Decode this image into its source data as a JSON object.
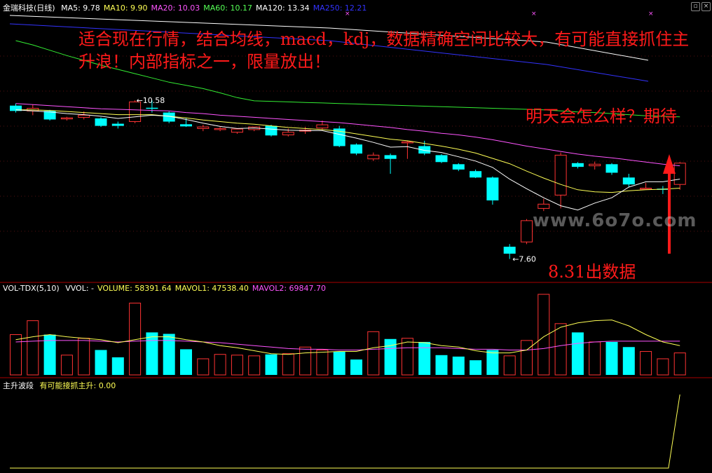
{
  "main_header": {
    "title": "金瑞科技(日线)",
    "items": [
      {
        "label": "MA5: 9.78",
        "color": "#ffffff"
      },
      {
        "label": "MA10: 9.90",
        "color": "#ffff55"
      },
      {
        "label": "MA20: 10.03",
        "color": "#ff55ff"
      },
      {
        "label": "MA60: 10.17",
        "color": "#55ff55"
      },
      {
        "label": "MA120: 13.34",
        "color": "#ffffff"
      },
      {
        "label": "MA250: 12.21",
        "color": "#3333ff"
      }
    ]
  },
  "volume_header": {
    "title": "VOL-TDX(5,10)",
    "items": [
      {
        "label": "VVOL: -",
        "color": "#ffffff"
      },
      {
        "label": "VOLUME: 58391.64",
        "color": "#ffff55"
      },
      {
        "label": "MAVOL1: 47538.40",
        "color": "#ffff55"
      },
      {
        "label": "MAVOL2: 69847.70",
        "color": "#ff55ff"
      }
    ]
  },
  "indicator_header": {
    "title": "主升波段",
    "items": [
      {
        "label": "有可能接抓主升: 0.00",
        "color": "#ffff55"
      }
    ]
  },
  "annotations": {
    "title": "适合现在行情，结合均线，macd，kdj，数据精确空间比较大，有可能直接抓住主升浪！内部指标之一，限量放出！",
    "tomorrow": "明天会怎么样？期待",
    "date_note": "8.31出数据"
  },
  "watermark": "www.6o7o.com",
  "chart_data": [
    {
      "type": "candlestick",
      "name": "金瑞科技(日线)",
      "ylim": [
        7.2,
        12.2
      ],
      "colors": {
        "up": "#ff3333",
        "down": "#00ffff",
        "ma5": "#ffffff",
        "ma10": "#ffff55",
        "ma20": "#ff55ff",
        "ma60": "#33ee33",
        "ma120": "#ffffff",
        "ma250": "#3333ff"
      },
      "candles": [
        {
          "o": 10.48,
          "h": 10.52,
          "l": 10.35,
          "c": 10.38
        },
        {
          "o": 10.38,
          "h": 10.5,
          "l": 10.3,
          "c": 10.43
        },
        {
          "o": 10.38,
          "h": 10.4,
          "l": 10.2,
          "c": 10.22
        },
        {
          "o": 10.23,
          "h": 10.27,
          "l": 10.2,
          "c": 10.25
        },
        {
          "o": 10.26,
          "h": 10.37,
          "l": 10.22,
          "c": 10.3
        },
        {
          "o": 10.24,
          "h": 10.26,
          "l": 10.08,
          "c": 10.1
        },
        {
          "o": 10.14,
          "h": 10.18,
          "l": 10.05,
          "c": 10.1
        },
        {
          "o": 10.18,
          "h": 10.58,
          "l": 10.15,
          "c": 10.55
        },
        {
          "o": 10.44,
          "h": 10.58,
          "l": 10.35,
          "c": 10.43
        },
        {
          "o": 10.35,
          "h": 10.37,
          "l": 10.15,
          "c": 10.18
        },
        {
          "o": 10.13,
          "h": 10.25,
          "l": 10.08,
          "c": 10.09
        },
        {
          "o": 10.05,
          "h": 10.12,
          "l": 10.0,
          "c": 10.08
        },
        {
          "o": 10.03,
          "h": 10.08,
          "l": 10.0,
          "c": 10.05
        },
        {
          "o": 9.98,
          "h": 10.05,
          "l": 9.95,
          "c": 10.04
        },
        {
          "o": 10.03,
          "h": 10.08,
          "l": 10.0,
          "c": 10.08
        },
        {
          "o": 10.1,
          "h": 10.12,
          "l": 9.9,
          "c": 9.92
        },
        {
          "o": 9.93,
          "h": 10.05,
          "l": 9.9,
          "c": 9.98
        },
        {
          "o": 10.0,
          "h": 10.08,
          "l": 9.95,
          "c": 10.02
        },
        {
          "o": 10.06,
          "h": 10.2,
          "l": 10.02,
          "c": 10.12
        },
        {
          "o": 10.05,
          "h": 10.1,
          "l": 9.7,
          "c": 9.72
        },
        {
          "o": 9.75,
          "h": 9.77,
          "l": 9.55,
          "c": 9.58
        },
        {
          "o": 9.48,
          "h": 9.6,
          "l": 9.44,
          "c": 9.55
        },
        {
          "o": 9.55,
          "h": 9.58,
          "l": 9.2,
          "c": 9.48
        },
        {
          "o": 9.78,
          "h": 9.82,
          "l": 9.48,
          "c": 9.8
        },
        {
          "o": 9.72,
          "h": 9.82,
          "l": 9.55,
          "c": 9.58
        },
        {
          "o": 9.55,
          "h": 9.57,
          "l": 9.4,
          "c": 9.42
        },
        {
          "o": 9.38,
          "h": 9.4,
          "l": 9.25,
          "c": 9.28
        },
        {
          "o": 9.25,
          "h": 9.28,
          "l": 9.12,
          "c": 9.13
        },
        {
          "o": 9.13,
          "h": 9.15,
          "l": 8.62,
          "c": 8.7
        },
        {
          "o": 7.83,
          "h": 7.88,
          "l": 7.6,
          "c": 7.7
        },
        {
          "o": 7.92,
          "h": 8.35,
          "l": 7.88,
          "c": 8.32
        },
        {
          "o": 8.55,
          "h": 8.73,
          "l": 8.5,
          "c": 8.63
        },
        {
          "o": 8.8,
          "h": 9.6,
          "l": 8.55,
          "c": 9.55
        },
        {
          "o": 9.4,
          "h": 9.42,
          "l": 9.3,
          "c": 9.33
        },
        {
          "o": 9.35,
          "h": 9.43,
          "l": 9.28,
          "c": 9.38
        },
        {
          "o": 9.38,
          "h": 9.4,
          "l": 9.18,
          "c": 9.22
        },
        {
          "o": 9.13,
          "h": 9.2,
          "l": 8.95,
          "c": 9.0
        },
        {
          "o": 8.92,
          "h": 9.03,
          "l": 8.9,
          "c": 8.93
        },
        {
          "o": 8.92,
          "h": 8.97,
          "l": 8.82,
          "c": 8.9
        },
        {
          "o": 9.0,
          "h": 9.42,
          "l": 8.9,
          "c": 9.4
        }
      ],
      "ma5": [
        10.4,
        10.38,
        10.36,
        10.33,
        10.31,
        10.28,
        10.24,
        10.27,
        10.3,
        10.28,
        10.22,
        10.15,
        10.09,
        10.05,
        10.06,
        10.04,
        10.02,
        10.01,
        10.01,
        9.94,
        9.87,
        9.79,
        9.7,
        9.71,
        9.64,
        9.6,
        9.52,
        9.44,
        9.32,
        9.1,
        8.92,
        8.75,
        8.6,
        8.52,
        8.65,
        8.75,
        8.95,
        9.05,
        9.05,
        9.1
      ],
      "ma10": [
        10.4,
        10.4,
        10.39,
        10.37,
        10.35,
        10.33,
        10.31,
        10.31,
        10.31,
        10.28,
        10.25,
        10.21,
        10.18,
        10.15,
        10.13,
        10.1,
        10.07,
        10.05,
        10.03,
        10.0,
        9.95,
        9.9,
        9.85,
        9.82,
        9.77,
        9.72,
        9.66,
        9.59,
        9.49,
        9.39,
        9.25,
        9.12,
        9.0,
        8.9,
        8.86,
        8.85,
        8.88,
        8.9,
        8.91,
        8.93
      ],
      "ma20": [
        10.52,
        10.5,
        10.48,
        10.46,
        10.44,
        10.42,
        10.41,
        10.4,
        10.39,
        10.38,
        10.35,
        10.33,
        10.3,
        10.28,
        10.26,
        10.24,
        10.22,
        10.2,
        10.18,
        10.16,
        10.13,
        10.1,
        10.07,
        10.03,
        10.0,
        9.96,
        9.93,
        9.89,
        9.84,
        9.78,
        9.72,
        9.67,
        9.62,
        9.57,
        9.53,
        9.5,
        9.46,
        9.42,
        9.38,
        9.35
      ],
      "ma60": [
        11.7,
        11.62,
        11.52,
        11.42,
        11.33,
        11.24,
        11.16,
        11.08,
        11.0,
        10.92,
        10.86,
        10.8,
        10.72,
        10.63,
        10.57,
        10.56,
        10.55,
        10.54,
        10.53,
        10.52,
        10.51,
        10.5,
        10.49,
        10.48,
        10.47,
        10.46,
        10.45,
        10.44,
        10.43,
        10.42,
        10.41,
        10.4,
        10.38,
        10.36,
        10.35,
        10.33,
        10.31,
        10.29,
        10.28,
        10.27
      ]
    },
    {
      "type": "bar",
      "name": "VOL-TDX(5,10)",
      "ylim": [
        0,
        110000
      ],
      "values": [
        55000,
        74000,
        55000,
        27000,
        50000,
        34000,
        24000,
        98000,
        58000,
        56000,
        35000,
        22000,
        28000,
        27000,
        26000,
        28000,
        29000,
        38000,
        34000,
        32000,
        21000,
        59000,
        49000,
        50000,
        45000,
        27000,
        25000,
        20000,
        34000,
        26000,
        47000,
        110000,
        70000,
        58000,
        45000,
        45000,
        38000,
        32000,
        22000,
        30000
      ],
      "up": [
        true,
        true,
        false,
        true,
        true,
        false,
        false,
        true,
        false,
        false,
        false,
        true,
        true,
        true,
        true,
        false,
        true,
        true,
        true,
        false,
        false,
        true,
        false,
        true,
        false,
        false,
        false,
        false,
        false,
        true,
        true,
        true,
        true,
        false,
        true,
        false,
        false,
        true,
        true,
        true
      ],
      "mavol1": [
        48000,
        52000,
        55000,
        52000,
        50000,
        48000,
        44000,
        48000,
        52000,
        52000,
        48000,
        45000,
        40000,
        37000,
        33000,
        29000,
        28000,
        30000,
        31000,
        32000,
        32000,
        37000,
        40000,
        45000,
        44000,
        40000,
        38000,
        33000,
        30000,
        30000,
        34000,
        52000,
        65000,
        71000,
        74000,
        75000,
        67000,
        55000,
        45000,
        40000
      ],
      "mavol2": [
        45000,
        46000,
        47000,
        47000,
        47000,
        46000,
        45000,
        46000,
        47000,
        47000,
        46000,
        45000,
        44000,
        42000,
        40000,
        38000,
        36000,
        35000,
        35000,
        34000,
        34000,
        35000,
        36000,
        37000,
        37000,
        37000,
        36000,
        35000,
        35000,
        34000,
        34000,
        36000,
        40000,
        43000,
        45000,
        46000,
        46000,
        46000,
        46000,
        46000
      ]
    },
    {
      "type": "line",
      "name": "主升波段",
      "ylim": [
        0,
        1
      ],
      "series": [
        {
          "name": "有可能接抓主升",
          "values": [
            0,
            0,
            0,
            0,
            0,
            0,
            0,
            0,
            0,
            0,
            0,
            0,
            0,
            0,
            0,
            0,
            0,
            0,
            0,
            0,
            0,
            0,
            0,
            0,
            0,
            0,
            0,
            0,
            0,
            0,
            0,
            0,
            0,
            0,
            0,
            0,
            0,
            0,
            0,
            1
          ]
        }
      ]
    }
  ]
}
